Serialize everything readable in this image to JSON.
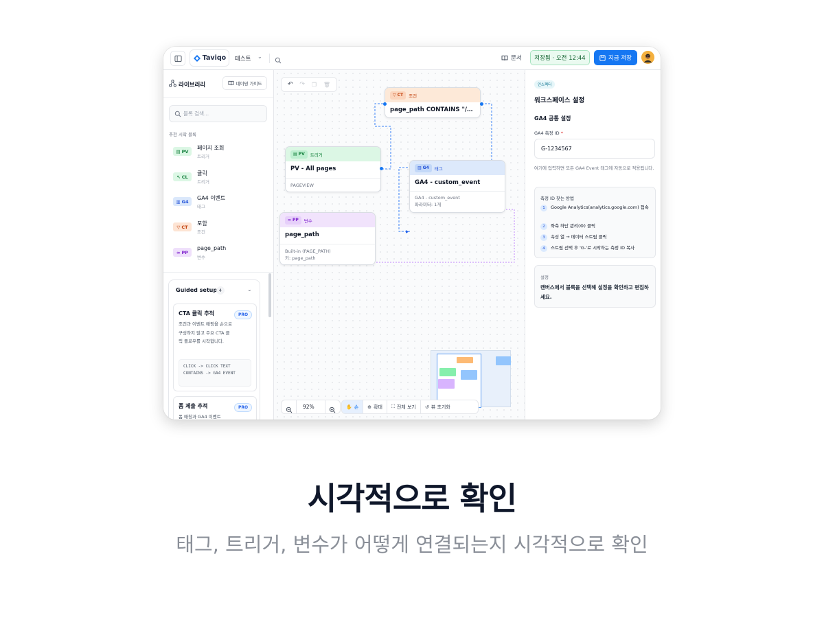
{
  "topbar": {
    "logo": "Taviqo",
    "workspace": "테스트",
    "docs": "문서",
    "saved_status": "저장됨 · 오전 12:44",
    "save_button": "지금 저장"
  },
  "sidebar": {
    "title": "라이브러리",
    "naming_guide": "네이밍 가이드",
    "search_placeholder": "블록 검색...",
    "section_label": "추천 시작 블록",
    "items": [
      {
        "badge": "PV",
        "name": "페이지 조회",
        "sub": "트리거"
      },
      {
        "badge": "CL",
        "name": "클릭",
        "sub": "트리거"
      },
      {
        "badge": "G4",
        "name": "GA4 이벤트",
        "sub": "태그"
      },
      {
        "badge": "CT",
        "name": "포함",
        "sub": "조건"
      },
      {
        "badge": "PP",
        "name": "page_path",
        "sub": "변수"
      }
    ],
    "guided": {
      "title": "Guided setup",
      "count": "4",
      "cards": [
        {
          "title": "CTA 클릭 추적",
          "badge": "PRO",
          "desc": "조건과 이벤트 매핑을 손으로 구성하지 않고 주요 CTA 클릭 플로우를 시작합니다.",
          "code": "CLICK -> CLICK TEXT CONTAINS -> GA4 EVENT"
        },
        {
          "title": "폼 제출 추적",
          "badge": "PRO",
          "desc": "폼 매칭과 GA4 이벤트"
        }
      ]
    }
  },
  "canvas": {
    "nodes": {
      "ct": {
        "tag": "CT",
        "type": "조건",
        "title": "page_path CONTAINS \"/prici..."
      },
      "pv": {
        "tag": "PV",
        "type": "트리거",
        "title": "PV - All pages",
        "meta": "PAGEVIEW"
      },
      "ga4": {
        "tag": "G4",
        "type": "태그",
        "title": "GA4 - custom_event",
        "meta1": "GA4 - custom_event",
        "meta2": "파라미터: 1개"
      },
      "pp": {
        "tag": "PP",
        "type": "변수",
        "title": "page_path",
        "meta1": "Built-in (PAGE_PATH)",
        "meta2": "키: page_path"
      }
    },
    "zoom": "92%",
    "tools": {
      "hand": "손",
      "zoom_in": "확대",
      "fit": "전체 보기",
      "reset": "뷰 초기화"
    }
  },
  "inspector": {
    "badge": "인스펙터",
    "title": "워크스페이스 설정",
    "subtitle": "GA4 공통 설정",
    "field_label": "GA4 측정 ID",
    "required_mark": "*",
    "field_value": "G-1234567",
    "help": "여기에 입력하면 모든 GA4 Event 태그에 자동으로 적용됩니다.",
    "howto_title": "측정 ID 찾는 방법",
    "steps": [
      {
        "num": "1",
        "text": "Google Analytics(analytics.google.com) 접속"
      },
      {
        "num": "2",
        "text": "좌측 하단 관리(⚙) 클릭"
      },
      {
        "num": "3",
        "text": "속성 열 → 데이터 스트림 클릭"
      },
      {
        "num": "4",
        "text": "스트림 선택 후 'G-'로 시작하는 측정 ID 복사"
      }
    ],
    "settings_title": "설정",
    "settings_text": "캔버스에서 블록을 선택해 설정을 확인하고 편집하세요."
  },
  "headline": "시각적으로 확인",
  "subline": "태그, 트리거, 변수가 어떻게 연결되는지 시각적으로 확인",
  "colors": {
    "accent": "#1677f2",
    "trigger": "#15803d",
    "tag": "#1d4ed8",
    "condition": "#c2410c",
    "variable": "#7e22ce"
  }
}
